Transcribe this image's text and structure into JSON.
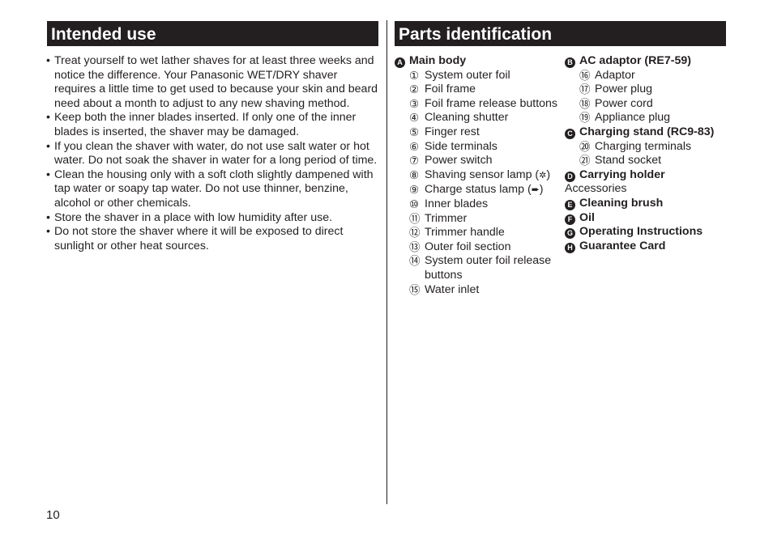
{
  "page_number": "10",
  "intended_use": {
    "title": "Intended use",
    "bullet_symbol": "•",
    "bullets": [
      "Treat yourself to wet lather shaves for at least three weeks and notice the difference. Your Panasonic WET/DRY shaver requires a little time to get used to because your skin and beard need about a month to adjust to any new shaving method.",
      "Keep both the inner blades inserted. If only one of the inner blades is inserted, the shaver may be damaged.",
      "If you clean the shaver with water, do not use salt water or hot water. Do not soak the shaver in water for a long period of time.",
      "Clean the housing only with a soft cloth slightly dampened with tap water or soapy tap water. Do not use thinner, benzine, alcohol or other chemicals.",
      "Store the shaver in a place with low humidity after use.",
      "Do not store the shaver where it will be exposed to direct sunlight or other heat sources."
    ]
  },
  "parts_identification": {
    "title": "Parts identification",
    "main_body": {
      "badge": "A",
      "label": "Main body",
      "items": [
        {
          "num": "①",
          "label": "System outer foil"
        },
        {
          "num": "②",
          "label": "Foil frame"
        },
        {
          "num": "③",
          "label": "Foil frame release buttons"
        },
        {
          "num": "④",
          "label": "Cleaning shutter"
        },
        {
          "num": "⑤",
          "label": "Finger rest"
        },
        {
          "num": "⑥",
          "label": "Side terminals"
        },
        {
          "num": "⑦",
          "label": "Power switch"
        },
        {
          "num": "⑧",
          "label": "Shaving sensor lamp (shaving-sensor-icon)"
        },
        {
          "num": "⑨",
          "label": "Charge status lamp (plug-icon)"
        },
        {
          "num": "⑩",
          "label": "Inner blades"
        },
        {
          "num": "⑪",
          "label": "Trimmer"
        },
        {
          "num": "⑫",
          "label": "Trimmer handle"
        },
        {
          "num": "⑬",
          "label": "Outer foil section"
        },
        {
          "num": "⑭",
          "label": "System outer foil release buttons"
        },
        {
          "num": "⑮",
          "label": "Water inlet"
        }
      ]
    },
    "ac_adaptor": {
      "badge": "B",
      "label": "AC adaptor (RE7-59)",
      "items": [
        {
          "num": "⑯",
          "label": "Adaptor"
        },
        {
          "num": "⑰",
          "label": "Power plug"
        },
        {
          "num": "⑱",
          "label": "Power cord"
        },
        {
          "num": "⑲",
          "label": "Appliance plug"
        }
      ]
    },
    "charging_stand": {
      "badge": "C",
      "label": "Charging stand (RC9-83)",
      "items": [
        {
          "num": "⑳",
          "label": "Charging terminals"
        },
        {
          "num": "㉑",
          "label": "Stand socket"
        }
      ]
    },
    "carrying_holder": {
      "badge": "D",
      "label": "Carrying holder"
    },
    "accessories_label": "Accessories",
    "accessories": [
      {
        "badge": "E",
        "label": "Cleaning brush"
      },
      {
        "badge": "F",
        "label": "Oil"
      },
      {
        "badge": "G",
        "label": "Operating Instructions"
      },
      {
        "badge": "H",
        "label": "Guarantee Card"
      }
    ],
    "sensor_lamp_text": "Shaving sensor lamp",
    "charge_lamp_text": "Charge status lamp"
  }
}
